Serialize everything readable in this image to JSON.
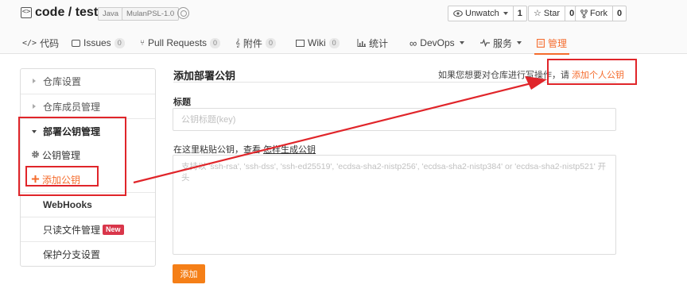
{
  "repo": {
    "owner": "code",
    "separator": "/",
    "name": "test",
    "language_tag": "Java",
    "license_tag": "MulanPSL-1.0"
  },
  "actions": {
    "watch": {
      "label": "Unwatch",
      "count": "1"
    },
    "star": {
      "label": "Star",
      "count": "0"
    },
    "fork": {
      "label": "Fork",
      "count": "0"
    }
  },
  "tabs": [
    {
      "label": "代码",
      "icon": "code-icon"
    },
    {
      "label": "Issues",
      "badge": "0",
      "icon": "issues-icon"
    },
    {
      "label": "Pull Requests",
      "badge": "0",
      "icon": "pull-request-icon"
    },
    {
      "label": "附件",
      "badge": "0",
      "icon": "paperclip-icon"
    },
    {
      "label": "Wiki",
      "badge": "0",
      "icon": "wiki-icon"
    },
    {
      "label": "统计",
      "icon": "bar-chart-icon"
    },
    {
      "label": "DevOps",
      "icon": "infinity-icon"
    },
    {
      "label": "服务",
      "icon": "pulse-icon"
    },
    {
      "label": "管理",
      "icon": "manage-icon",
      "active": true
    }
  ],
  "sidebar": {
    "items": [
      {
        "label": "仓库设置"
      },
      {
        "label": "仓库成员管理"
      },
      {
        "label": "部署公钥管理"
      },
      {
        "label": "公钥管理"
      },
      {
        "label": "添加公钥"
      },
      {
        "label": "WebHooks"
      },
      {
        "label": "只读文件管理",
        "badge": "New"
      },
      {
        "label": "保护分支设置"
      }
    ]
  },
  "main": {
    "title": "添加部署公钥",
    "hint_prefix": "如果您想要对仓库进行写操作，请",
    "hint_link": "添加个人公钥",
    "title_label": "标题",
    "title_placeholder": "公钥标题(key)",
    "key_label_prefix": "在这里粘贴公钥，查看",
    "key_label_link": "怎样生成公钥",
    "key_placeholder": "支持以 'ssh-rsa', 'ssh-dss', 'ssh-ed25519', 'ecdsa-sha2-nistp256', 'ecdsa-sha2-nistp384' or 'ecdsa-sha2-nistp521' 开头",
    "submit_label": "添加"
  },
  "colors": {
    "accent": "#f56c2d",
    "button": "#f57f17",
    "annotation": "#e0252a",
    "new_badge": "#d9364a"
  }
}
